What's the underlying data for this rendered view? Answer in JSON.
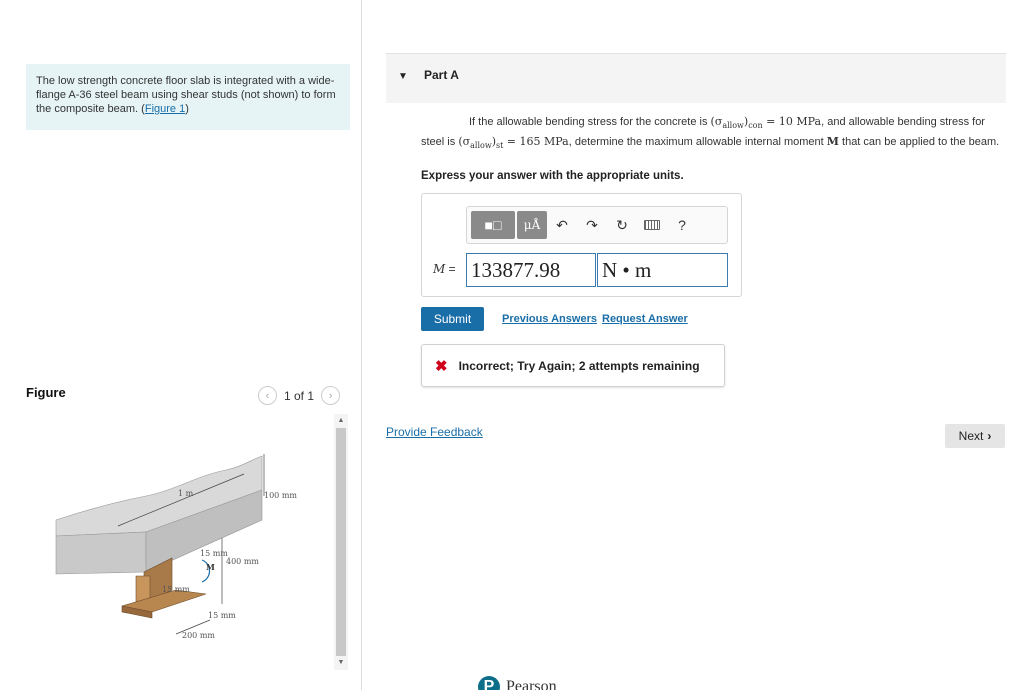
{
  "problem": {
    "text": "The low strength concrete floor slab is integrated with a wide-flange A-36 steel beam using shear studs (not shown) to form the composite beam.",
    "figure_link": "Figure 1"
  },
  "figure_panel": {
    "label": "Figure",
    "counter": "1 of 1",
    "dims": {
      "length": "1 m",
      "slab_thick": "100 mm",
      "top_flange": "15 mm",
      "moment": "M",
      "web_height": "400 mm",
      "web_thick": "15 mm",
      "bottom_flange": "15 mm",
      "flange_width": "200 mm"
    }
  },
  "part": {
    "title": "Part A",
    "q_pre": "If the allowable bending stress for the concrete is",
    "q_con_sym": "(σ",
    "q_con_sub": "allow",
    "q_con_close": ")",
    "q_con_sub2": "con",
    "q_con_val": " = 10 MPa",
    "q_mid": ", and allowable bending stress for steel is",
    "q_st_sym": "(σ",
    "q_st_sub": "allow",
    "q_st_close": ")",
    "q_st_sub2": "st",
    "q_st_val": " = 165 MPa",
    "q_post1": ", determine the maximum allowable internal moment",
    "q_M": "M",
    "q_post2": "that can be applied to the beam.",
    "express": "Express your answer with the appropriate units."
  },
  "answer": {
    "label_var": "M",
    "label_eq": " = ",
    "value": "133877.98",
    "units": "N • m",
    "toolbar": {
      "mu_label": "μÅ",
      "undo": "↶",
      "redo": "↷",
      "reset": "↻",
      "help": "?"
    }
  },
  "actions": {
    "submit": "Submit",
    "previous_answers": "Previous Answers",
    "request_answer": "Request Answer"
  },
  "feedback": {
    "icon": "✖",
    "text": "Incorrect; Try Again; 2 attempts remaining"
  },
  "footer": {
    "provide_feedback": "Provide Feedback",
    "next": "Next",
    "brand": "Pearson"
  },
  "colors": {
    "accent": "#1a6ea8",
    "problem_bg": "#e6f4f6",
    "error": "#d0021b"
  }
}
